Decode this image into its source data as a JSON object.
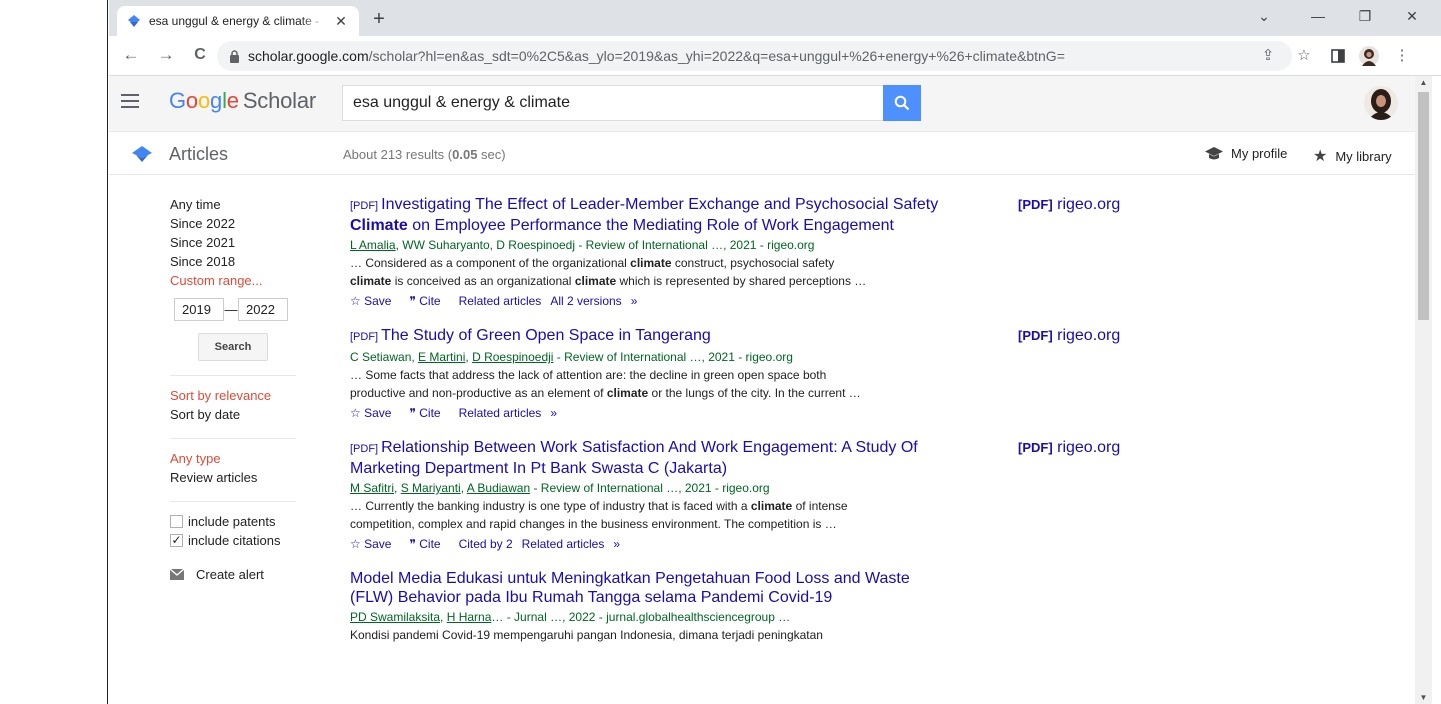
{
  "browser": {
    "tab_title": "esa unggul & energy & climate -",
    "url_host": "scholar.google.com",
    "url_path": "/scholar?hl=en&as_sdt=0%2C5&as_ylo=2019&as_yhi=2022&q=esa+unggul+%26+energy+%26+climate&btnG=",
    "new_tab": "+",
    "close_tab": "✕"
  },
  "header": {
    "logo_google": [
      "G",
      "o",
      "o",
      "g",
      "l",
      "e"
    ],
    "logo_scholar": "Scholar",
    "query": "esa unggul & energy & climate"
  },
  "subheader": {
    "section": "Articles",
    "stats_pre": "About 213 results (",
    "stats_time": "0.05",
    "stats_post": " sec)",
    "my_profile": "My profile",
    "my_library": "My library"
  },
  "sidebar": {
    "time": [
      "Any time",
      "Since 2022",
      "Since 2021",
      "Since 2018"
    ],
    "custom_range": "Custom range...",
    "year_from": "2019",
    "year_to": "2022",
    "dash": "—",
    "search_button": "Search",
    "sort_relevance": "Sort by relevance",
    "sort_date": "Sort by date",
    "any_type": "Any type",
    "review_articles": "Review articles",
    "include_patents": "include patents",
    "include_citations": "include citations",
    "create_alert": "Create alert"
  },
  "results": [
    {
      "pdf_tag": "[PDF]",
      "title_a": "Investigating The Effect of Leader-Member Exchange and Psychosocial Safety ",
      "title_b": "Climate",
      "title_c": " on Employee Performance the Mediating Role of Work Engagement",
      "author1": "L Amalia",
      "authors_rest": ", WW Suharyanto, D Roespinoedj - Review of International …, 2021 - rigeo.org",
      "snip1a": "… Considered as a component of the organizational ",
      "snip1b": "climate",
      "snip1c": " construct, psychosocial safety",
      "snip2a": "climate",
      "snip2b": " is conceived as an organizational ",
      "snip2c": "climate",
      "snip2d": " which is represented by shared perceptions …",
      "save": "Save",
      "cite": "Cite",
      "related": "Related articles",
      "versions": "All 2 versions",
      "side_pdf": "[PDF]",
      "side_host": "rigeo.org"
    },
    {
      "pdf_tag": "[PDF]",
      "title_a": "The Study of Green Open Space in Tangerang",
      "author_plain1": "C Setiawan, ",
      "author1": "E Martini",
      "author_sep": ", ",
      "author2": "D Roespinoedji",
      "authors_rest": " - Review of International …, 2021 - rigeo.org",
      "snip1": "… Some facts that address the lack of attention are: the decline in green open space both",
      "snip2a": "productive and non-productive as an element of ",
      "snip2b": "climate",
      "snip2c": " or the lungs of the city. In the current …",
      "save": "Save",
      "cite": "Cite",
      "related": "Related articles",
      "side_pdf": "[PDF]",
      "side_host": "rigeo.org"
    },
    {
      "pdf_tag": "[PDF]",
      "title_a": "Relationship Between Work Satisfaction And Work Engagement: A Study Of Marketing Department In Pt Bank Swasta C (Jakarta)",
      "author1": "M Safitri",
      "author_sep": ", ",
      "author2": "S Mariyanti",
      "author_sep2": ", ",
      "author3": "A Budiawan",
      "authors_rest": " - Review of International …, 2021 - rigeo.org",
      "snip1a": "… Currently the banking industry is one type of industry that is faced with a ",
      "snip1b": "climate",
      "snip1c": " of intense",
      "snip2": "competition, complex and rapid changes in the business environment. The competition is …",
      "save": "Save",
      "cite": "Cite",
      "cited_by": "Cited by 2",
      "related": "Related articles",
      "side_pdf": "[PDF]",
      "side_host": "rigeo.org"
    },
    {
      "title_a": "Model Media Edukasi untuk Meningkatkan Pengetahuan Food Loss and Waste (FLW) Behavior pada Ibu Rumah Tangga selama Pandemi Covid-19",
      "author1": "PD Swamilaksita",
      "author_sep": ", ",
      "author2": "H Harna",
      "authors_rest": "… - Jurnal …, 2022 - jurnal.globalhealthsciencegroup …",
      "snip1": "Kondisi pandemi Covid-19 mempengaruhi pangan Indonesia, dimana terjadi peningkatan"
    }
  ],
  "colors": {
    "link": "#1a0dab",
    "author_green": "#006621",
    "selected_red": "#dd4b39",
    "search_blue": "#4d90fe"
  }
}
